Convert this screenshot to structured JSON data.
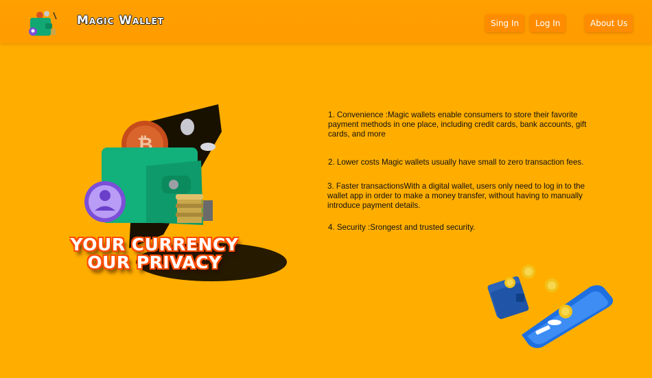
{
  "header": {
    "brand": "Magic Wallet",
    "nav": {
      "sign_in": "Sing In",
      "log_in": "Log In",
      "about_us": "About Us"
    }
  },
  "hero": {
    "slogan_line1": "YOUR CURRENCY",
    "slogan_line2": "OUR PRIVACY"
  },
  "features": [
    "1. Convenience  :Magic wallets enable consumers to store their favorite payment methods in one place, including credit cards, bank accounts, gift cards, and more",
    "2. Lower costs Magic wallets usually have small to zero transaction fees.",
    "3. Faster transactionsWith a digital wallet, users only need to log in to the wallet app in order to make a money transfer, without having to manually introduce payment details.",
    "4. Security :Srongest and trusted security."
  ],
  "colors": {
    "background": "#ffae00",
    "navbar": "#ff9e00",
    "button": "#ff8c00",
    "slogan_outline": "#ff4a00",
    "wallet_green": "#12b07a"
  },
  "icons": {
    "logo": "wallet-coins-icon",
    "hero": "wallet-bitcoin-user-icon",
    "illustration": "phone-wallet-coins-icon"
  }
}
